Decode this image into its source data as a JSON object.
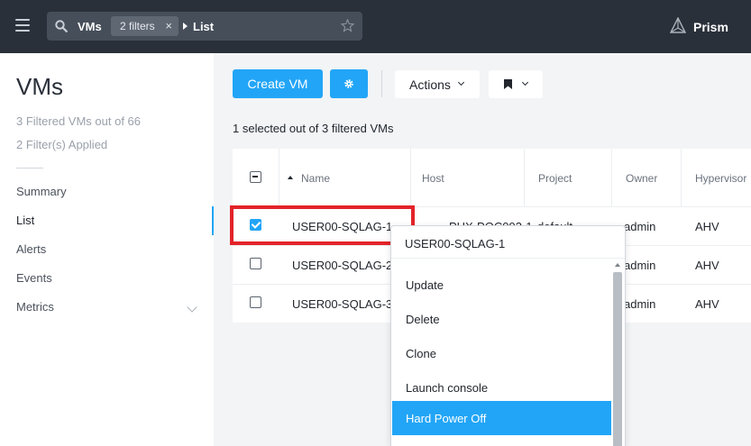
{
  "topbar": {
    "menu_icon": "hamburger-icon",
    "search": {
      "icon": "search-icon",
      "entity": "VMs",
      "filter_chip": "2 filters",
      "filter_remove": "×",
      "view": "List",
      "favorite_icon": "star-icon"
    },
    "brand": {
      "logo_icon": "prism-logo-icon",
      "label": "Prism"
    }
  },
  "sidebar": {
    "title": "VMs",
    "meta": [
      "3 Filtered VMs out of 66",
      "2 Filter(s) Applied"
    ],
    "nav": [
      {
        "label": "Summary",
        "active": false
      },
      {
        "label": "List",
        "active": true
      },
      {
        "label": "Alerts",
        "active": false
      },
      {
        "label": "Events",
        "active": false
      },
      {
        "label": "Metrics",
        "active": false,
        "expandable": true
      }
    ]
  },
  "toolbar": {
    "create_label": "Create VM",
    "settings_icon": "gear-icon",
    "actions_label": "Actions",
    "bookmark_icon": "bookmark-icon"
  },
  "selection_text": "1 selected out of 3 filtered VMs",
  "table": {
    "columns": [
      "Name",
      "Host",
      "Project",
      "Owner",
      "Hypervisor"
    ],
    "rows": [
      {
        "checked": true,
        "name": "USER00-SQLAG-1",
        "host": "PHX-POC093-1",
        "project": "default",
        "owner": "admin",
        "hypervisor": "AHV"
      },
      {
        "checked": false,
        "name": "USER00-SQLAG-2",
        "owner": "admin",
        "hypervisor": "AHV"
      },
      {
        "checked": false,
        "name": "USER00-SQLAG-3",
        "owner": "admin",
        "hypervisor": "AHV"
      }
    ]
  },
  "context_menu": {
    "header": "USER00-SQLAG-1",
    "items": [
      "Update",
      "Delete",
      "Clone",
      "Launch console",
      "Hard Power Off"
    ],
    "active_index": 4
  },
  "colors": {
    "accent": "#22a5f7",
    "topbar": "#2a3039",
    "highlight": "#e3232a"
  }
}
